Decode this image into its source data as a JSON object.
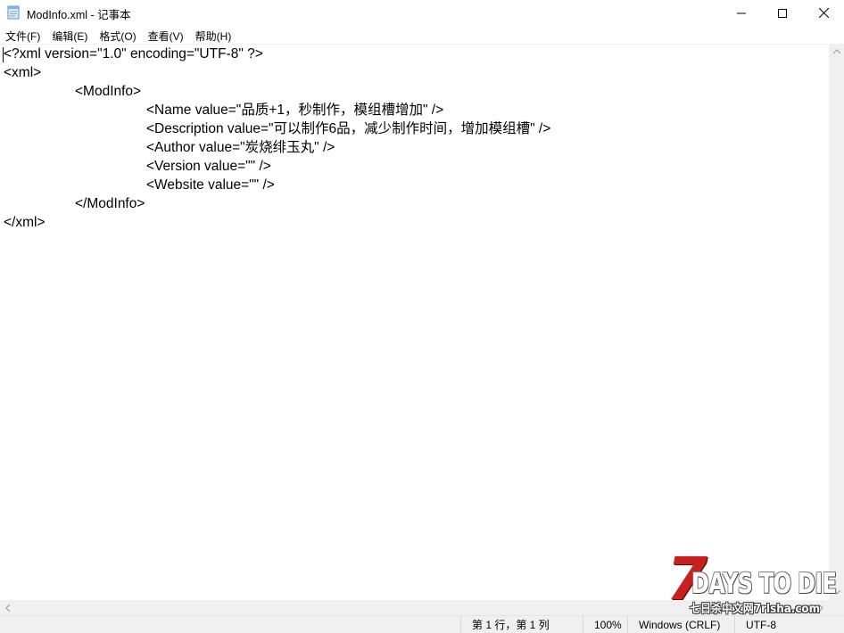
{
  "window": {
    "title": "ModInfo.xml - 记事本",
    "minimize_glyph": "—",
    "maximize_glyph": "☐",
    "close_glyph": "✕"
  },
  "menu": {
    "items": [
      "文件(F)",
      "编辑(E)",
      "格式(O)",
      "查看(V)",
      "帮助(H)"
    ]
  },
  "editor": {
    "lines": [
      "<?xml version=\"1.0\" encoding=\"UTF-8\" ?>",
      "<xml>",
      "<ModInfo>",
      "<Name value=\"品质+1，秒制作，模组槽增加\" />",
      "<Description value=\"可以制作6品，减少制作时间，增加模组槽\" />",
      "<Author value=\"炭烧绯玉丸\" />",
      "<Version value=\"\" />",
      "<Website value=\"\" />",
      "</ModInfo>",
      "</xml>"
    ]
  },
  "statusbar": {
    "position": "第 1 行，第 1 列",
    "zoom": "100%",
    "line_ending": "Windows (CRLF)",
    "encoding": "UTF-8"
  },
  "watermark": {
    "seven": "7",
    "title": "DAYS TO DIE",
    "subtitle": "七日杀中文网7rlsha.com"
  }
}
